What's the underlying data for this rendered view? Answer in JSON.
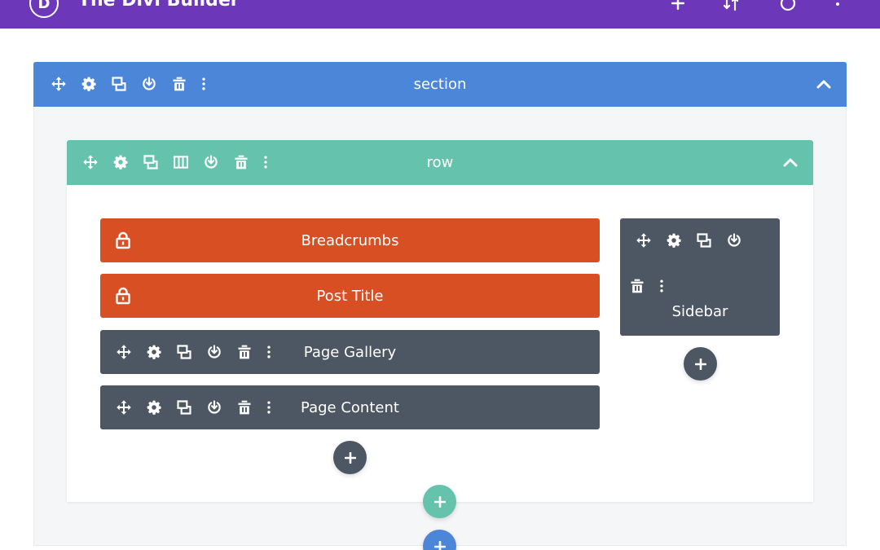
{
  "app": {
    "title": "The Divi Builder",
    "logo_letter": "D"
  },
  "colors": {
    "topbar": "#6c37b8",
    "section": "#4b86d9",
    "row": "#65c3ad",
    "module_locked": "#d94f24",
    "module_dark": "#4d5763"
  },
  "section": {
    "label": "section",
    "icons": [
      "move-icon",
      "settings-icon",
      "duplicate-icon",
      "save-icon",
      "delete-icon",
      "more-icon"
    ]
  },
  "row": {
    "label": "row",
    "icons": [
      "move-icon",
      "settings-icon",
      "duplicate-icon",
      "columns-icon",
      "save-icon",
      "delete-icon",
      "more-icon"
    ]
  },
  "modules": [
    {
      "label": "Breadcrumbs",
      "locked": true
    },
    {
      "label": "Post Title",
      "locked": true
    },
    {
      "label": "Page Gallery",
      "locked": false
    },
    {
      "label": "Page Content",
      "locked": false
    }
  ],
  "sidebar": {
    "label": "Sidebar"
  }
}
